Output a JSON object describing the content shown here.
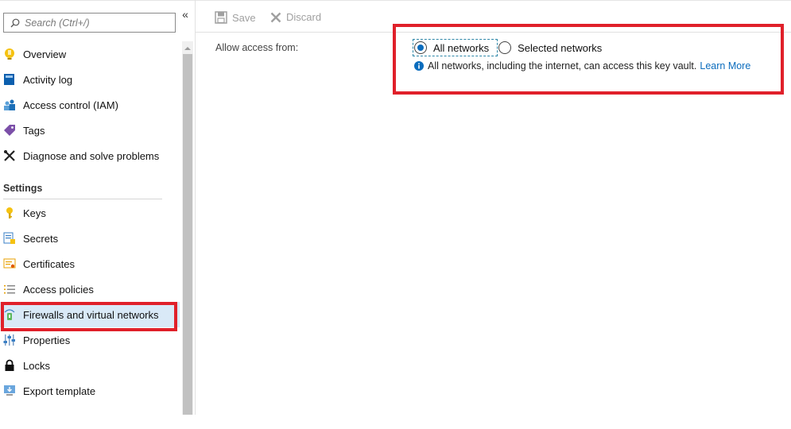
{
  "sidebar": {
    "search_placeholder": "Search (Ctrl+/)",
    "collapse_glyph": "«",
    "items_top": [
      {
        "label": "Overview",
        "icon": "lightbulb-icon"
      },
      {
        "label": "Activity log",
        "icon": "log-book-icon"
      },
      {
        "label": "Access control (IAM)",
        "icon": "people-icon"
      },
      {
        "label": "Tags",
        "icon": "tag-icon"
      },
      {
        "label": "Diagnose and solve problems",
        "icon": "wrench-icon"
      }
    ],
    "settings_header": "Settings",
    "items_settings": [
      {
        "label": "Keys",
        "icon": "key-icon"
      },
      {
        "label": "Secrets",
        "icon": "secret-icon"
      },
      {
        "label": "Certificates",
        "icon": "certificate-icon"
      },
      {
        "label": "Access policies",
        "icon": "list-icon"
      },
      {
        "label": "Firewalls and virtual networks",
        "icon": "firewall-icon",
        "active": true
      },
      {
        "label": "Properties",
        "icon": "sliders-icon"
      },
      {
        "label": "Locks",
        "icon": "lock-icon"
      },
      {
        "label": "Export template",
        "icon": "export-icon"
      }
    ]
  },
  "toolbar": {
    "save_label": "Save",
    "discard_label": "Discard"
  },
  "content": {
    "allow_access_label": "Allow access from:",
    "options": [
      {
        "label": "All networks",
        "selected": true
      },
      {
        "label": "Selected networks",
        "selected": false
      }
    ],
    "info_text": "All networks, including the internet, can access this key vault.",
    "learn_more": "Learn More"
  },
  "colors": {
    "accent": "#0b6cbd",
    "highlight_box": "#e0202a",
    "active_item_bg": "#d9e9f7"
  }
}
